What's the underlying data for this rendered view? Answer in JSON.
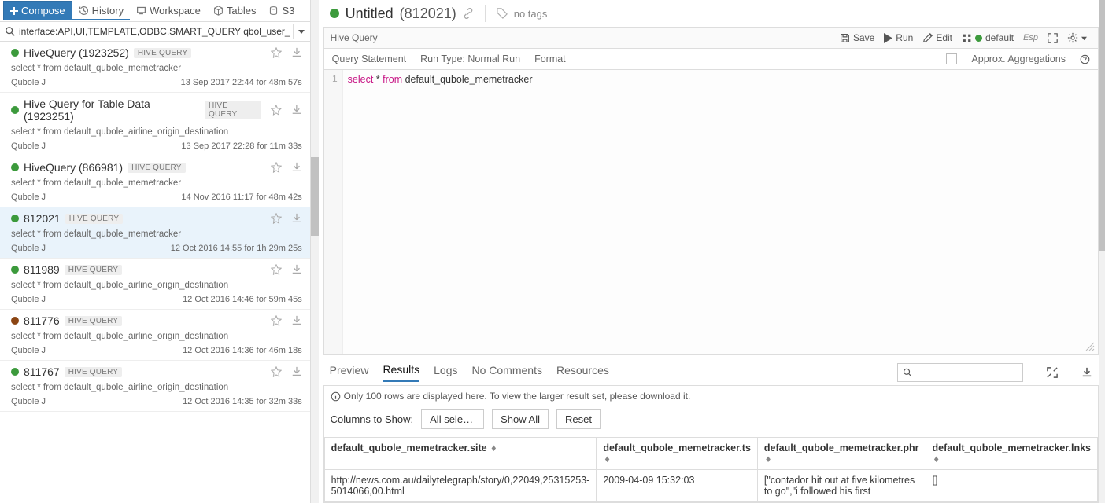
{
  "tabs": {
    "compose": "Compose",
    "history": "History",
    "workspace": "Workspace",
    "tables": "Tables",
    "s3": "S3"
  },
  "search": {
    "value": "interface:API,UI,TEMPLATE,ODBC,SMART_QUERY qbol_user_id:"
  },
  "history": [
    {
      "title": "HiveQuery (1923252)",
      "badge": "HIVE QUERY",
      "dot": "green",
      "snippet": "select * from default_qubole_memetracker",
      "user": "Qubole J",
      "time": "13 Sep 2017 22:44 for 48m 57s",
      "sel": false
    },
    {
      "title": "Hive Query for Table Data (1923251)",
      "badge": "HIVE QUERY",
      "dot": "green",
      "snippet": "select * from default_qubole_airline_origin_destination",
      "user": "Qubole J",
      "time": "13 Sep 2017 22:28 for 11m 33s",
      "sel": false
    },
    {
      "title": "HiveQuery (866981)",
      "badge": "HIVE QUERY",
      "dot": "green",
      "snippet": "select * from default_qubole_memetracker",
      "user": "Qubole J",
      "time": "14 Nov 2016 11:17 for 48m 42s",
      "sel": false
    },
    {
      "title": "812021",
      "badge": "HIVE QUERY",
      "dot": "green",
      "snippet": "select * from default_qubole_memetracker",
      "user": "Qubole J",
      "time": "12 Oct 2016 14:55 for 1h 29m 25s",
      "sel": true
    },
    {
      "title": "811989",
      "badge": "HIVE QUERY",
      "dot": "green",
      "snippet": "select * from default_qubole_airline_origin_destination",
      "user": "Qubole J",
      "time": "12 Oct 2016 14:46 for 59m 45s",
      "sel": false
    },
    {
      "title": "811776",
      "badge": "HIVE QUERY",
      "dot": "brown",
      "snippet": "select * from default_qubole_airline_origin_destination",
      "user": "Qubole J",
      "time": "12 Oct 2016 14:36 for 46m 18s",
      "sel": false
    },
    {
      "title": "811767",
      "badge": "HIVE QUERY",
      "dot": "green",
      "snippet": "select * from default_qubole_airline_origin_destination",
      "user": "Qubole J",
      "time": "12 Oct 2016 14:35 for 32m 33s",
      "sel": false
    }
  ],
  "header": {
    "title": "Untitled",
    "id": "(812021)",
    "notags": "no tags"
  },
  "toolbar": {
    "label": "Hive Query",
    "save": "Save",
    "run": "Run",
    "edit": "Edit",
    "default": "default",
    "esp": "Esp"
  },
  "subbar": {
    "qs": "Query Statement",
    "runtype": "Run Type: Normal Run",
    "format": "Format",
    "approx": "Approx. Aggregations"
  },
  "editor": {
    "line": "1",
    "kw1": "select",
    "s1": " * ",
    "kw2": "from",
    "s2": " default_qubole_memetracker"
  },
  "rtabs": {
    "preview": "Preview",
    "results": "Results",
    "logs": "Logs",
    "nocomments": "No Comments",
    "resources": "Resources"
  },
  "info": "Only 100 rows are displayed here. To view the larger result set, please download it.",
  "cols": {
    "label": "Columns to Show:",
    "select": "All select…",
    "showall": "Show All",
    "reset": "Reset"
  },
  "table": {
    "h1": "default_qubole_memetracker.site",
    "h2": "default_qubole_memetracker.ts",
    "h3": "default_qubole_memetracker.phr",
    "h4": "default_qubole_memetracker.lnks",
    "r1c1": "http://news.com.au/dailytelegraph/story/0,22049,25315253-5014066,00.html",
    "r1c2": "2009-04-09 15:32:03",
    "r1c3": "[\"contador hit out at five kilometres to go\",\"i followed his first",
    "r1c4": "[]"
  }
}
